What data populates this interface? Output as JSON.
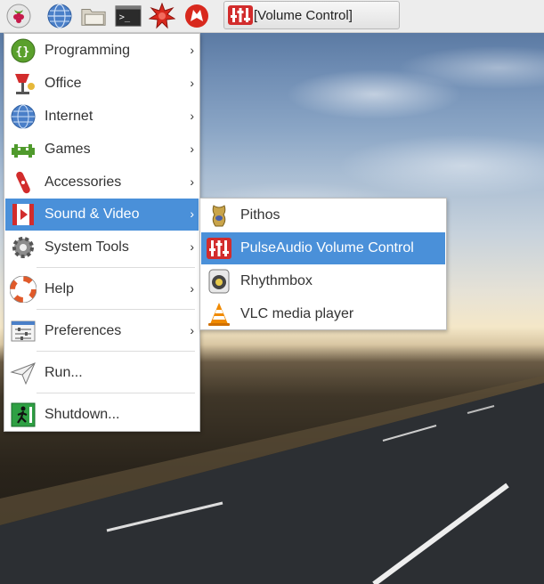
{
  "panel": {
    "launchers": [
      {
        "icon": "raspberry-icon"
      },
      {
        "icon": "globe-icon"
      },
      {
        "icon": "folder-icon"
      },
      {
        "icon": "terminal-icon"
      },
      {
        "icon": "math-icon"
      },
      {
        "icon": "wolfram-icon"
      }
    ],
    "task_button": {
      "icon": "volume-control-icon",
      "label": "[Volume Control]"
    }
  },
  "main_menu": {
    "items": [
      {
        "label": "Programming",
        "icon": "programming-icon",
        "submenu": true
      },
      {
        "label": "Office",
        "icon": "office-icon",
        "submenu": true
      },
      {
        "label": "Internet",
        "icon": "internet-icon",
        "submenu": true
      },
      {
        "label": "Games",
        "icon": "games-icon",
        "submenu": true
      },
      {
        "label": "Accessories",
        "icon": "accessories-icon",
        "submenu": true
      },
      {
        "label": "Sound & Video",
        "icon": "sound-video-icon",
        "submenu": true,
        "active": true
      },
      {
        "label": "System Tools",
        "icon": "system-tools-icon",
        "submenu": true
      },
      {
        "label": "Help",
        "icon": "help-icon",
        "submenu": true
      },
      {
        "label": "Preferences",
        "icon": "preferences-icon",
        "submenu": true
      },
      {
        "label": "Run...",
        "icon": "run-icon",
        "submenu": false
      },
      {
        "label": "Shutdown...",
        "icon": "shutdown-icon",
        "submenu": false
      }
    ],
    "arrow": "›"
  },
  "submenu": {
    "items": [
      {
        "label": "Pithos",
        "icon": "pithos-icon"
      },
      {
        "label": "PulseAudio Volume Control",
        "icon": "pulseaudio-icon",
        "active": true
      },
      {
        "label": "Rhythmbox",
        "icon": "rhythmbox-icon"
      },
      {
        "label": "VLC media player",
        "icon": "vlc-icon"
      }
    ]
  },
  "colors": {
    "highlight": "#4a90d9",
    "panel": "#ededed"
  }
}
